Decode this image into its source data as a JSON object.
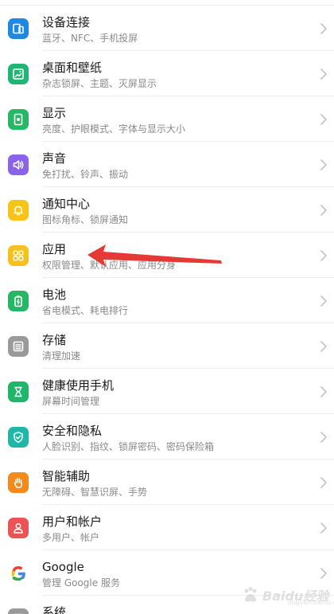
{
  "settings_items": [
    {
      "title": "设备连接",
      "subtitle": "蓝牙、NFC、手机投屏",
      "icon": "device-connect-icon",
      "color": "#1E88E5"
    },
    {
      "title": "桌面和壁纸",
      "subtitle": "杂志锁屏、主题、灭屏显示",
      "icon": "wallpaper-icon",
      "color": "#21B573"
    },
    {
      "title": "显示",
      "subtitle": "亮度、护眼模式、字体与显示大小",
      "icon": "display-icon",
      "color": "#27B766"
    },
    {
      "title": "声音",
      "subtitle": "免打扰、铃声、振动",
      "icon": "sound-icon",
      "color": "#8A63E8"
    },
    {
      "title": "通知中心",
      "subtitle": "图标角标、锁屏通知",
      "icon": "bell-icon",
      "color": "#F7C417"
    },
    {
      "title": "应用",
      "subtitle": "权限管理、默认应用、应用分身",
      "icon": "apps-grid-icon",
      "color": "#F6C01D"
    },
    {
      "title": "电池",
      "subtitle": "省电模式、耗电排行",
      "icon": "battery-icon",
      "color": "#24B865"
    },
    {
      "title": "存储",
      "subtitle": "清理加速",
      "icon": "storage-icon",
      "color": "#9A9A9A"
    },
    {
      "title": "健康使用手机",
      "subtitle": "屏幕时间管理",
      "icon": "hourglass-icon",
      "color": "#1FB56B"
    },
    {
      "title": "安全和隐私",
      "subtitle": "人脸识别、指纹、锁屏密码、密码保险箱",
      "icon": "shield-icon",
      "color": "#1FB8A8"
    },
    {
      "title": "智能辅助",
      "subtitle": "无障碍、智慧识屏、手势",
      "icon": "hand-icon",
      "color": "#F28A1E"
    },
    {
      "title": "用户和帐户",
      "subtitle": "多用户、帐户",
      "icon": "user-icon",
      "color": "#EA5455"
    },
    {
      "title": "Google",
      "subtitle": "管理 Google 服务",
      "icon": "google-g-icon",
      "color": "#4285F4"
    },
    {
      "title": "系统",
      "subtitle": "",
      "icon": "system-icon",
      "color": "#9A9A9A"
    }
  ],
  "annotation": {
    "color": "#E53935",
    "target_item": "应用"
  },
  "watermark": {
    "text": "Baidu经验",
    "sub": "jingyan.baidu.com"
  },
  "colors": {
    "chevron": "#C4C4C4",
    "divider": "#EEEEEE",
    "title": "#1A1A1A",
    "subtitle": "#8A8A8A"
  }
}
